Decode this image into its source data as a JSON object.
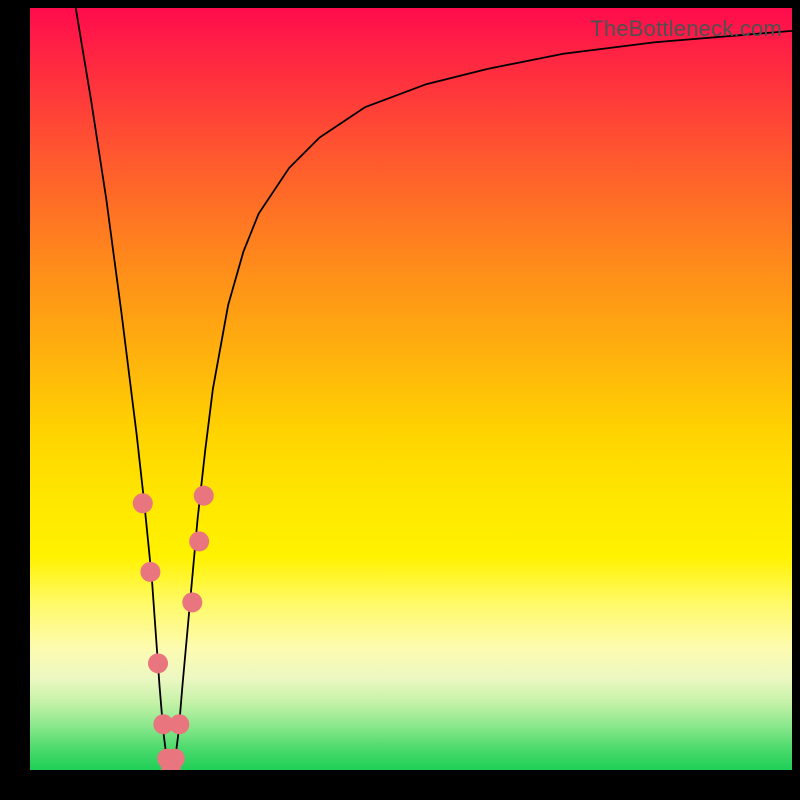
{
  "watermark": "TheBottleneck.com",
  "chart_data": {
    "type": "line",
    "title": "",
    "xlabel": "",
    "ylabel": "",
    "xlim": [
      0,
      100
    ],
    "ylim": [
      0,
      100
    ],
    "series": [
      {
        "name": "bottleneck-curve",
        "x": [
          6,
          8,
          10,
          12,
          13,
          14,
          15,
          16,
          16.5,
          17,
          17.5,
          18,
          18.5,
          19,
          19.5,
          20,
          21,
          22,
          23,
          24,
          26,
          28,
          30,
          34,
          38,
          44,
          52,
          60,
          70,
          82,
          94,
          100
        ],
        "y": [
          100,
          88,
          75,
          60,
          52,
          44,
          35,
          25,
          18,
          11,
          5,
          1,
          0,
          1,
          5,
          11,
          22,
          33,
          42,
          50,
          61,
          68,
          73,
          79,
          83,
          87,
          90,
          92,
          94,
          95.5,
          96.5,
          97
        ]
      }
    ],
    "markers": {
      "series": "bottleneck-curve",
      "points": [
        {
          "x": 14.8,
          "y": 35
        },
        {
          "x": 15.8,
          "y": 26
        },
        {
          "x": 16.8,
          "y": 14
        },
        {
          "x": 17.5,
          "y": 6
        },
        {
          "x": 18.0,
          "y": 1.5
        },
        {
          "x": 18.5,
          "y": 0.5
        },
        {
          "x": 19.0,
          "y": 1.5
        },
        {
          "x": 19.6,
          "y": 6
        },
        {
          "x": 21.3,
          "y": 22
        },
        {
          "x": 22.2,
          "y": 30
        },
        {
          "x": 22.8,
          "y": 36
        }
      ],
      "radius": 10
    },
    "background_gradient": {
      "top": "#ff0b4d",
      "mid": "#ffe600",
      "bottom": "#1ecf57"
    }
  }
}
